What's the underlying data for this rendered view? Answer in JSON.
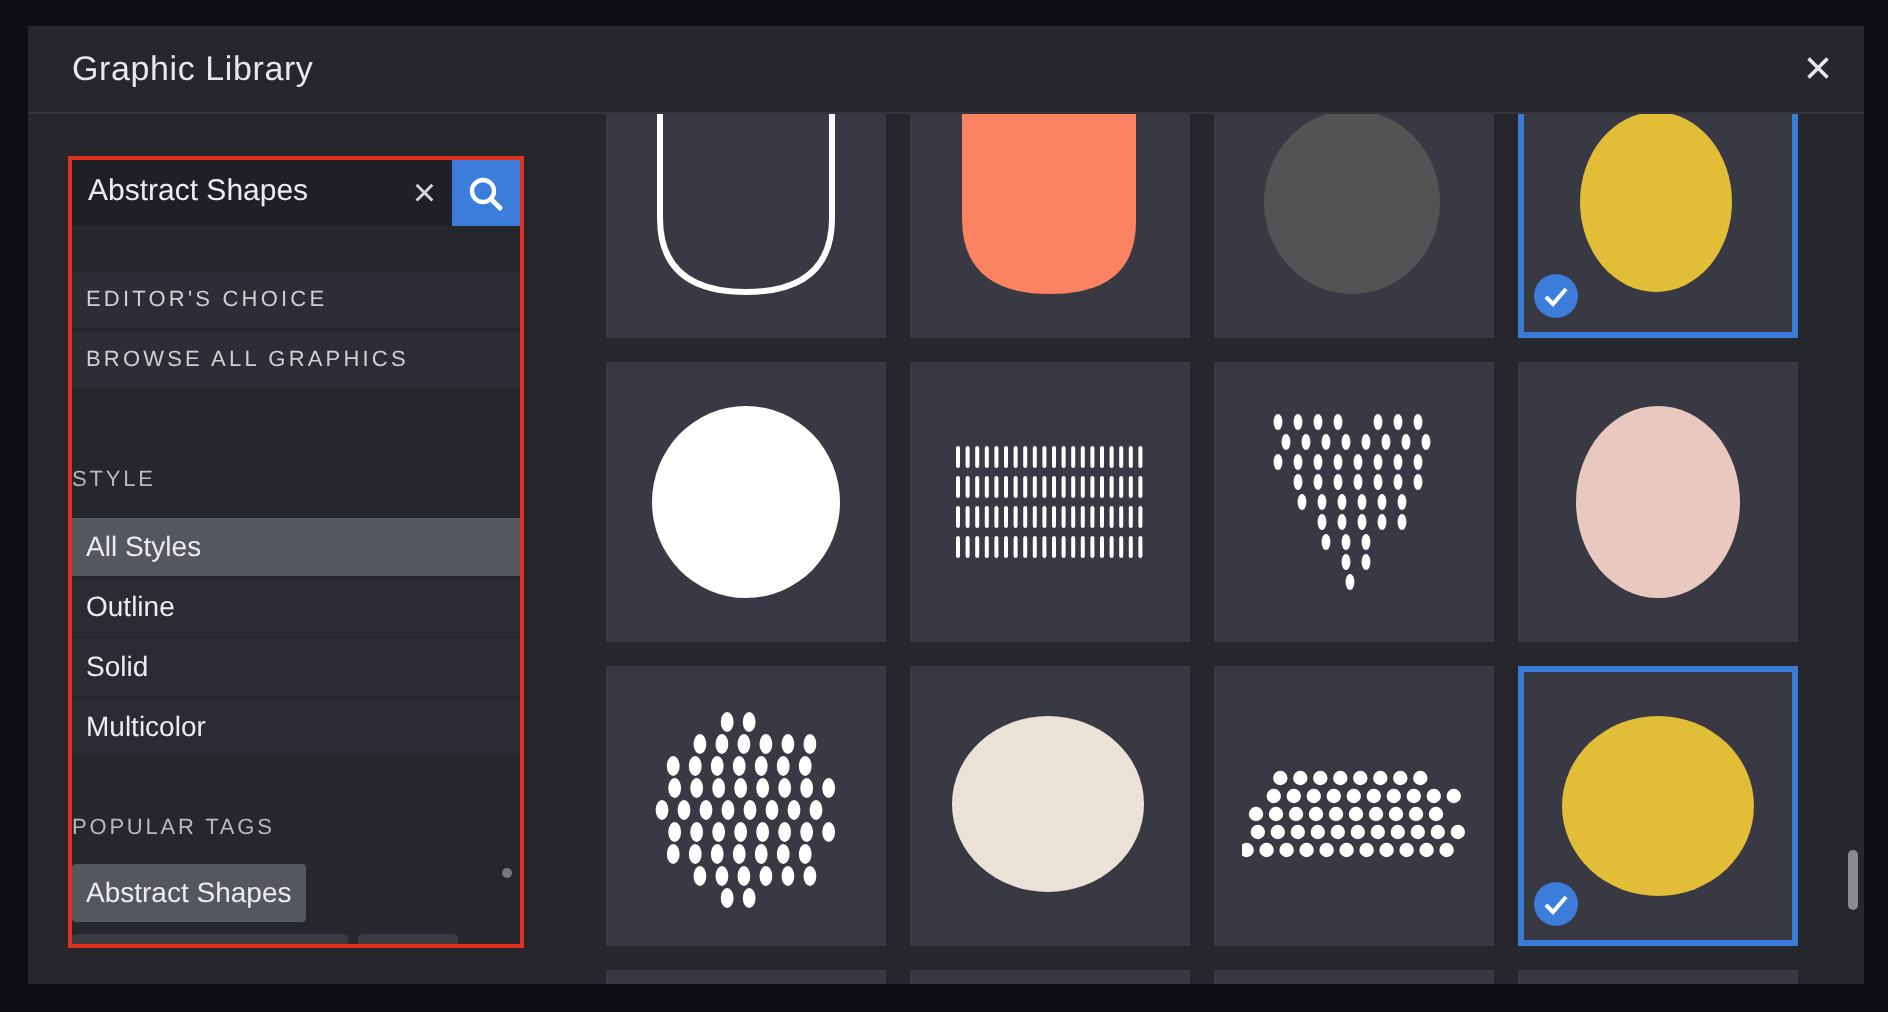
{
  "dialog": {
    "title": "Graphic Library",
    "close": "×"
  },
  "search": {
    "value": "Abstract Shapes",
    "clear": "×"
  },
  "links": [
    "EDITOR'S CHOICE",
    "BROWSE ALL GRAPHICS"
  ],
  "style": {
    "heading": "STYLE",
    "options": [
      {
        "label": "All Styles",
        "selected": true
      },
      {
        "label": "Outline",
        "selected": false
      },
      {
        "label": "Solid",
        "selected": false
      },
      {
        "label": "Multicolor",
        "selected": false
      }
    ]
  },
  "popular_tags": {
    "heading": "POPULAR TAGS",
    "tags": [
      {
        "label": "Abstract Shapes",
        "selected": true
      }
    ]
  },
  "graphics": [
    {
      "kind": "arch-outline",
      "selected": false
    },
    {
      "kind": "arch",
      "color": "#fb8361",
      "selected": false
    },
    {
      "kind": "blob",
      "color": "#545254",
      "selected": false
    },
    {
      "kind": "blob",
      "color": "#e2bd38",
      "selected": true
    },
    {
      "kind": "blob",
      "color": "#ffffff",
      "selected": false
    },
    {
      "kind": "dashes",
      "selected": false
    },
    {
      "kind": "heart-dots",
      "selected": false
    },
    {
      "kind": "blob",
      "color": "#e9c8bf",
      "selected": false
    },
    {
      "kind": "dot-cluster",
      "selected": false
    },
    {
      "kind": "blob",
      "color": "#ebe2d7",
      "selected": false
    },
    {
      "kind": "dot-mound",
      "selected": false
    },
    {
      "kind": "blob",
      "color": "#e2bd38",
      "selected": true
    },
    {
      "kind": "hidden",
      "selected": false
    },
    {
      "kind": "hidden",
      "selected": false
    },
    {
      "kind": "hidden",
      "selected": false
    },
    {
      "kind": "hidden",
      "selected": false
    }
  ]
}
